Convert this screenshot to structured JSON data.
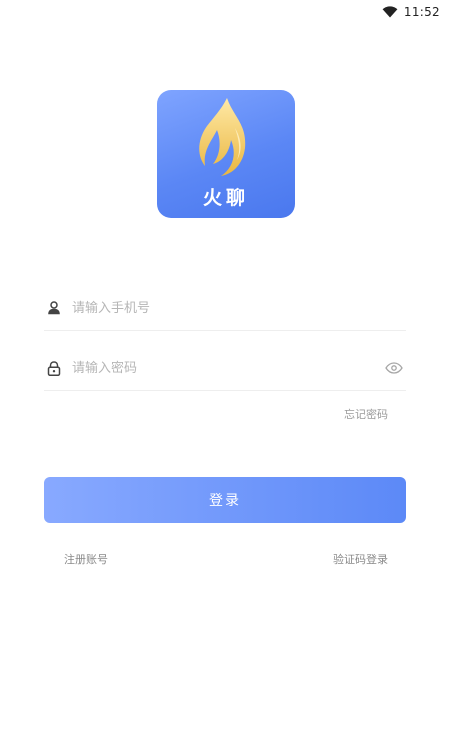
{
  "status_bar": {
    "time": "11:52",
    "wifi_icon": "wifi-icon"
  },
  "logo": {
    "icon": "flame-icon",
    "text": "火聊",
    "colors": {
      "background": "#5b87f5",
      "flame": "#f5cf72"
    }
  },
  "form": {
    "phone": {
      "placeholder": "请输入手机号",
      "value": "",
      "icon": "user-icon"
    },
    "password": {
      "placeholder": "请输入密码",
      "value": "",
      "icon": "lock-icon",
      "toggle_icon": "eye-icon"
    },
    "forgot_label": "忘记密码",
    "login_label": "登录"
  },
  "footer": {
    "register_label": "注册账号",
    "sms_login_label": "验证码登录"
  },
  "colors": {
    "accent": "#5c89f7",
    "placeholder": "#b6b6b6",
    "secondary_text": "#8a8a8a"
  }
}
